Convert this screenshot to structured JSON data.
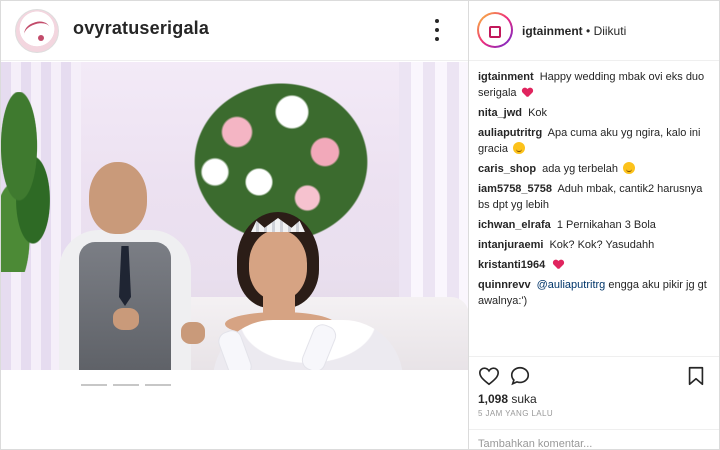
{
  "post": {
    "author": "ovyratuserigala",
    "more_icon": "three-dots-vertical-icon",
    "user_tag_icon": "person-icon"
  },
  "sidebar": {
    "account": "igtainment",
    "separator": "•",
    "follow_status": "Diikuti",
    "comments": [
      {
        "user": "igtainment",
        "text": "Happy wedding mbak ovi eks duo serigala",
        "emoji": "heart"
      },
      {
        "user": "nita_jwd",
        "text": "Kok"
      },
      {
        "user": "auliaputritrg",
        "text": "Apa cuma aku yg ngira, kalo ini gracia",
        "emoji": "sweat-smile"
      },
      {
        "user": "caris_shop",
        "text": "ada yg terbelah",
        "emoji": "smile"
      },
      {
        "user": "iam5758_5758",
        "text": "Aduh mbak, cantik2 harusnya bs dpt yg lebih"
      },
      {
        "user": "ichwan_elrafa",
        "text": "1 Pernikahan 3 Bola"
      },
      {
        "user": "intanjuraemi",
        "text": "Kok? Kok? Yasudahh"
      },
      {
        "user": "kristanti1964",
        "text": "",
        "emoji": "heart"
      },
      {
        "user": "quinnrevv",
        "mention": "@auliaputritrg",
        "text": "engga aku pikir jg gt awalnya:')"
      }
    ],
    "likes_count": "1,098",
    "likes_suffix": "suka",
    "time_ago": "5 JAM YANG LALU",
    "comment_placeholder": "Tambahkan komentar..."
  },
  "icons": {
    "like": "heart-outline-icon",
    "comment": "speech-bubble-icon",
    "save": "bookmark-icon"
  }
}
